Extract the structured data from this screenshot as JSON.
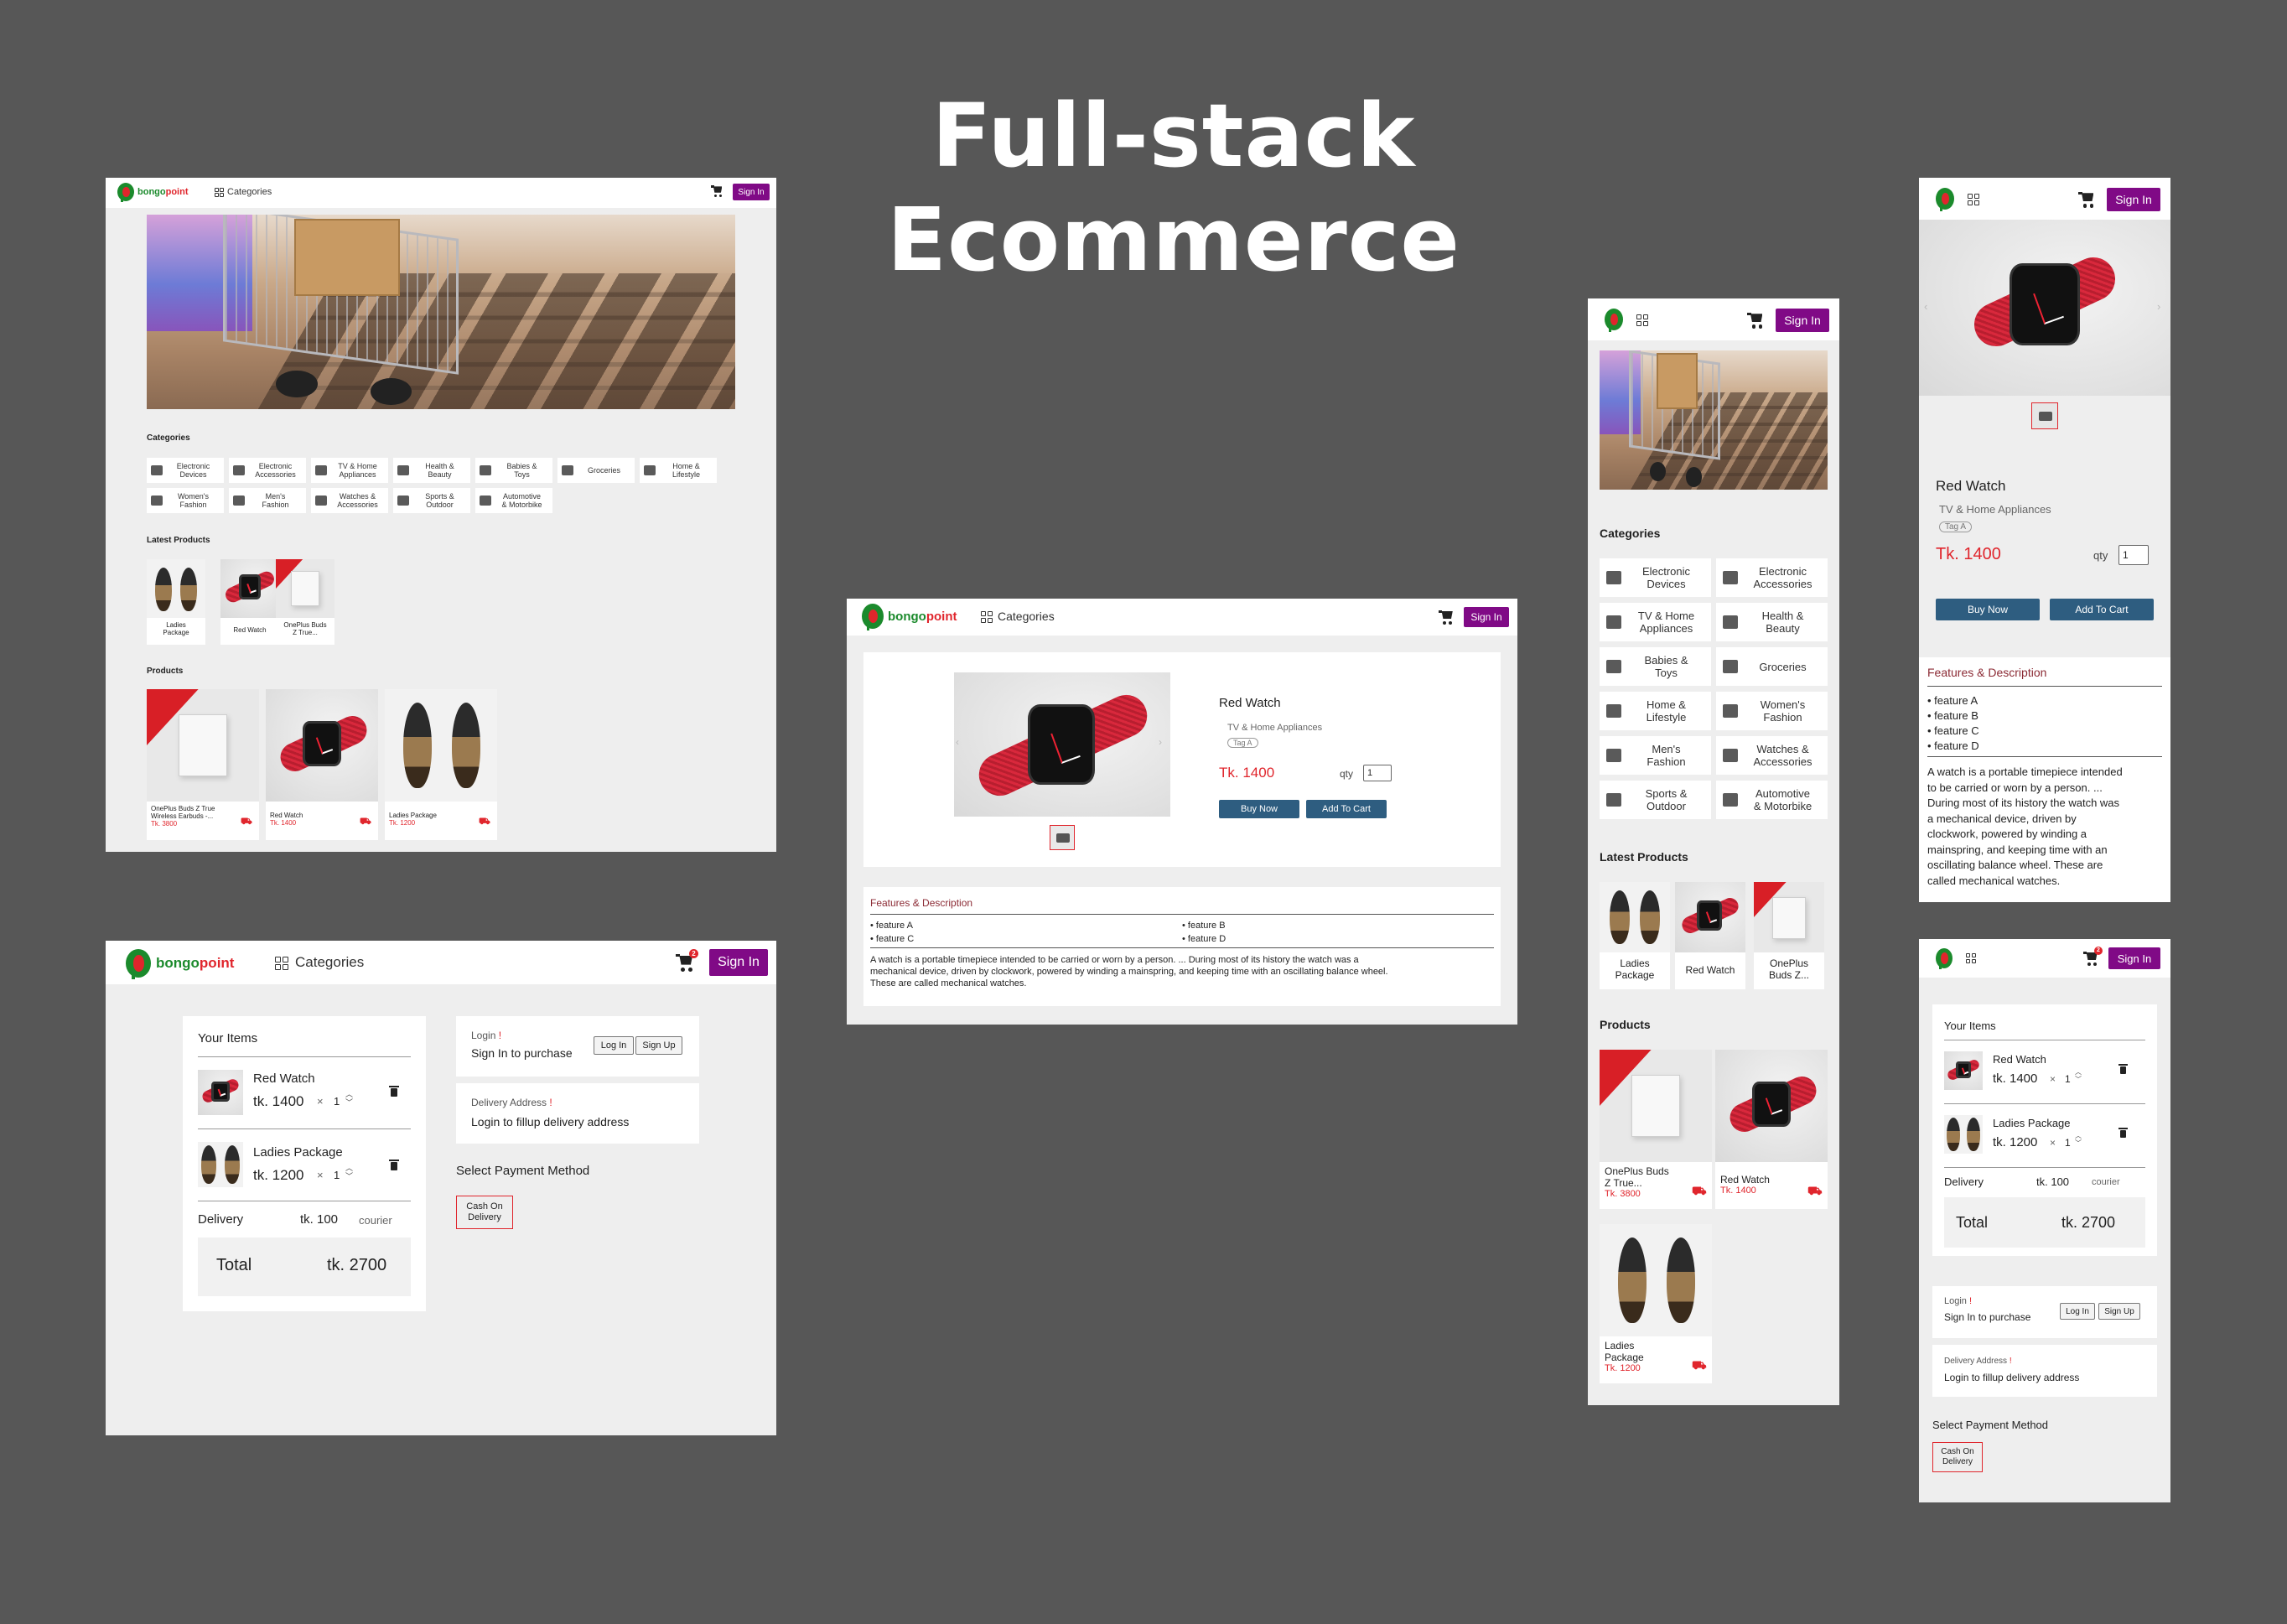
{
  "hero_title": {
    "line1": "Full-stack",
    "line2": "Ecommerce"
  },
  "brand": {
    "part1": "bongo",
    "part2": "point"
  },
  "nav": {
    "categories_label": "Categories",
    "sign_in": "Sign In",
    "cart_badge": "2"
  },
  "categories_heading": "Categories",
  "categories": [
    {
      "label1": "Electronic",
      "label2": "Devices"
    },
    {
      "label1": "Electronic",
      "label2": "Accessories"
    },
    {
      "label1": "TV & Home",
      "label2": "Appliances"
    },
    {
      "label1": "Health &",
      "label2": "Beauty"
    },
    {
      "label1": "Babies &",
      "label2": "Toys"
    },
    {
      "label1": "Groceries",
      "label2": ""
    },
    {
      "label1": "Home &",
      "label2": "Lifestyle"
    },
    {
      "label1": "Women's",
      "label2": "Fashion"
    },
    {
      "label1": "Men's",
      "label2": "Fashion"
    },
    {
      "label1": "Watches &",
      "label2": "Accessories"
    },
    {
      "label1": "Sports &",
      "label2": "Outdoor"
    },
    {
      "label1": "Automotive",
      "label2": "& Motorbike"
    }
  ],
  "latest_heading": "Latest Products",
  "latest": [
    {
      "name1": "Ladies",
      "name2": "Package"
    },
    {
      "name1": "Red Watch",
      "name2": ""
    },
    {
      "name1": "OnePlus Buds",
      "name2": "Z True..."
    }
  ],
  "latest_mobile": [
    {
      "name1": "Ladies",
      "name2": "Package"
    },
    {
      "name1": "Red Watch",
      "name2": ""
    },
    {
      "name1": "OnePlus",
      "name2": "Buds Z..."
    }
  ],
  "products_heading": "Products",
  "products": [
    {
      "name1": "OnePlus Buds Z True",
      "name2": "Wireless Earbuds -...",
      "price": "Tk. 3800"
    },
    {
      "name1": "Red Watch",
      "name2": "",
      "price": "Tk. 1400"
    },
    {
      "name1": "Ladies Package",
      "name2": "",
      "price": "Tk. 1200"
    }
  ],
  "products_mobile": [
    {
      "name1": "OnePlus Buds",
      "name2": "Z True...",
      "price": "Tk. 3800"
    },
    {
      "name1": "Red Watch",
      "name2": "",
      "price": "Tk. 1400"
    },
    {
      "name1": "Ladies",
      "name2": "Package",
      "price": "Tk. 1200"
    }
  ],
  "product_detail": {
    "name": "Red Watch",
    "category": "TV & Home Appliances",
    "tag": "Tag A",
    "price": "Tk. 1400",
    "qty_label": "qty",
    "qty_value": "1",
    "buy_now": "Buy Now",
    "add_to_cart": "Add To Cart",
    "features_heading": "Features & Description",
    "features": [
      "• feature A",
      "• feature B",
      "• feature C",
      "• feature D"
    ],
    "description_desktop_1": "A watch is a portable timepiece intended to be carried or worn by a person. ... During most of its history the watch was a",
    "description_desktop_2": "mechanical device, driven by clockwork, powered by winding a mainspring, and keeping time with an oscillating balance wheel.",
    "description_desktop_3": "These are called mechanical watches.",
    "description_mobile": [
      "A watch is a portable timepiece intended",
      "to be carried or worn by a person. ...",
      "During most of its history the watch was",
      "a mechanical device, driven by",
      "clockwork, powered by winding a",
      "mainspring, and keeping time with an",
      "oscillating balance wheel. These are",
      "called mechanical watches."
    ]
  },
  "cart": {
    "your_items": "Your Items",
    "items": [
      {
        "name": "Red Watch",
        "price": "tk. 1400",
        "times": "×",
        "qty": "1"
      },
      {
        "name": "Ladies Package",
        "price": "tk. 1200",
        "times": "×",
        "qty": "1"
      }
    ],
    "delivery_label": "Delivery",
    "delivery_price": "tk. 100",
    "delivery_method": "courier",
    "total_label": "Total",
    "total_value": "tk. 2700",
    "login_label": "Login",
    "required_mark": "!",
    "sign_in_to_purchase": "Sign In to purchase",
    "log_in": "Log In",
    "sign_up": "Sign Up",
    "delivery_address_label": "Delivery Address",
    "delivery_address_hint": "Login to fillup delivery address",
    "payment_heading": "Select Payment Method",
    "cod_1": "Cash On",
    "cod_2": "Delivery"
  },
  "colors": {
    "background": "#575757",
    "accent": "#800a86",
    "price": "#e0252c",
    "button": "#2e5d80",
    "brand_green": "#1b8a2c"
  }
}
